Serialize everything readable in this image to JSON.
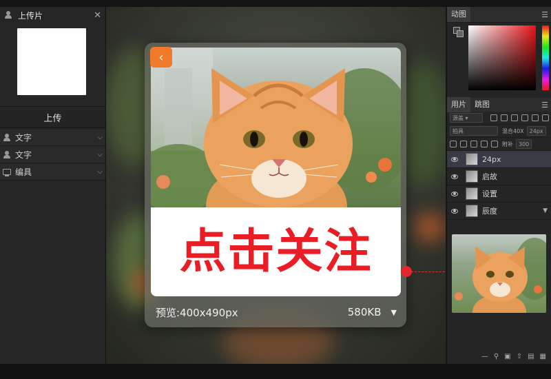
{
  "left_panel": {
    "header_title": "上传片",
    "close_glyph": "✕",
    "upload_label": "上传",
    "rows": [
      {
        "icon": "user-icon",
        "label": "文字"
      },
      {
        "icon": "user-icon",
        "label": "文字"
      },
      {
        "icon": "monitor-icon",
        "label": "编具"
      }
    ]
  },
  "preview": {
    "caption": "点击关注",
    "back_glyph": "‹",
    "dimensions": "预览:400x490px",
    "file_size": "580KB",
    "accent_color": "#f07a2a",
    "caption_color": "#ea1c24"
  },
  "right_panel": {
    "color_tab": "动图",
    "menu_glyph": "☰",
    "layers_tabs": [
      "用片",
      "跳图"
    ],
    "blend_mode": "源盖",
    "tool_row_label": "拍具",
    "opacity_label": "混合40X",
    "opacity_value": "24px",
    "fill_label": "附补",
    "fill_value": "300",
    "layers": [
      {
        "name": "24px",
        "selected": true
      },
      {
        "name": "启故",
        "selected": false
      },
      {
        "name": "设置",
        "selected": false
      },
      {
        "name": "辰度",
        "selected": false
      }
    ]
  }
}
